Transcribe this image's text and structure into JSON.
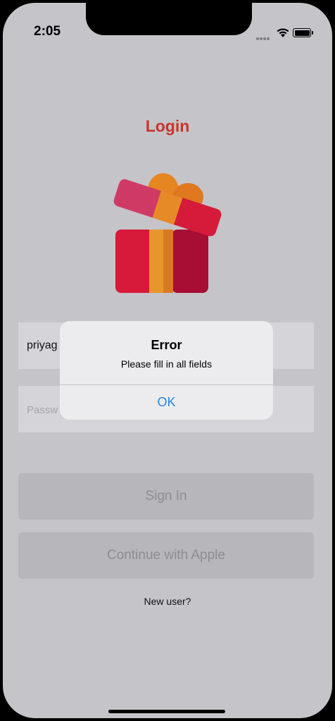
{
  "status_bar": {
    "time": "2:05"
  },
  "login": {
    "title": "Login",
    "title_color": "#c8342c",
    "email_value": "priyag",
    "password_placeholder": "Passw",
    "sign_in_label": "Sign In",
    "apple_label": "Continue with Apple",
    "new_user_label": "New user?"
  },
  "alert": {
    "title": "Error",
    "message": "Please fill in all fields",
    "ok_label": "OK",
    "ok_color": "#2a86d6"
  },
  "icons": [
    "gift-icon",
    "wifi-icon",
    "battery-icon",
    "signal-icon"
  ]
}
